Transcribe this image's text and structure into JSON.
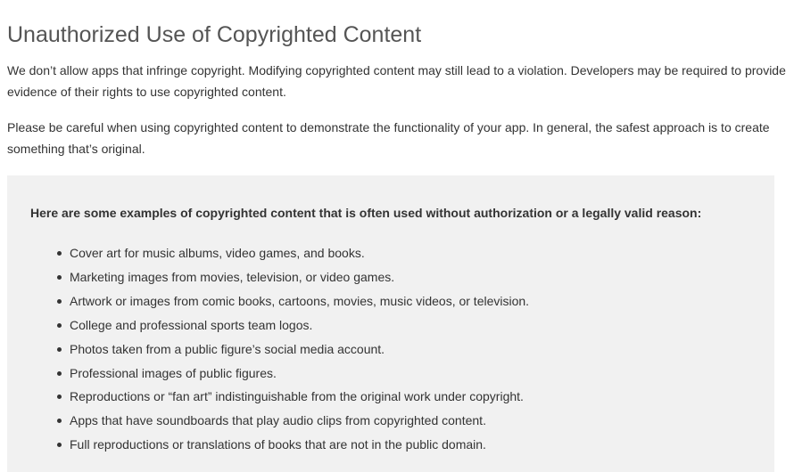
{
  "page": {
    "title": "Unauthorized Use of Copyrighted Content",
    "paragraphs": [
      "We don’t allow apps that infringe copyright. Modifying copyrighted content may still lead to a violation. Developers may be required to provide evidence of their rights to use copyrighted content.",
      "Please be careful when using copyrighted content to demonstrate the functionality of your app. In general, the safest approach is to create something that’s original."
    ]
  },
  "examples_box": {
    "heading": "Here are some examples of copyrighted content that is often used without authorization or a legally valid reason:",
    "items": [
      "Cover art for music albums, video games, and books.",
      "Marketing images from movies, television, or video games.",
      "Artwork or images from comic books, cartoons, movies, music videos, or television.",
      "College and professional sports team logos.",
      "Photos taken from a public figure’s social media account.",
      "Professional images of public figures.",
      "Reproductions or “fan art” indistinguishable from the original work under copyright.",
      "Apps that have soundboards that play audio clips from copyrighted content.",
      "Full reproductions or translations of books that are not in the public domain."
    ]
  },
  "colors": {
    "background": "#ffffff",
    "box_background": "#f1f1f1",
    "title_text": "#555555",
    "body_text": "#333333"
  }
}
